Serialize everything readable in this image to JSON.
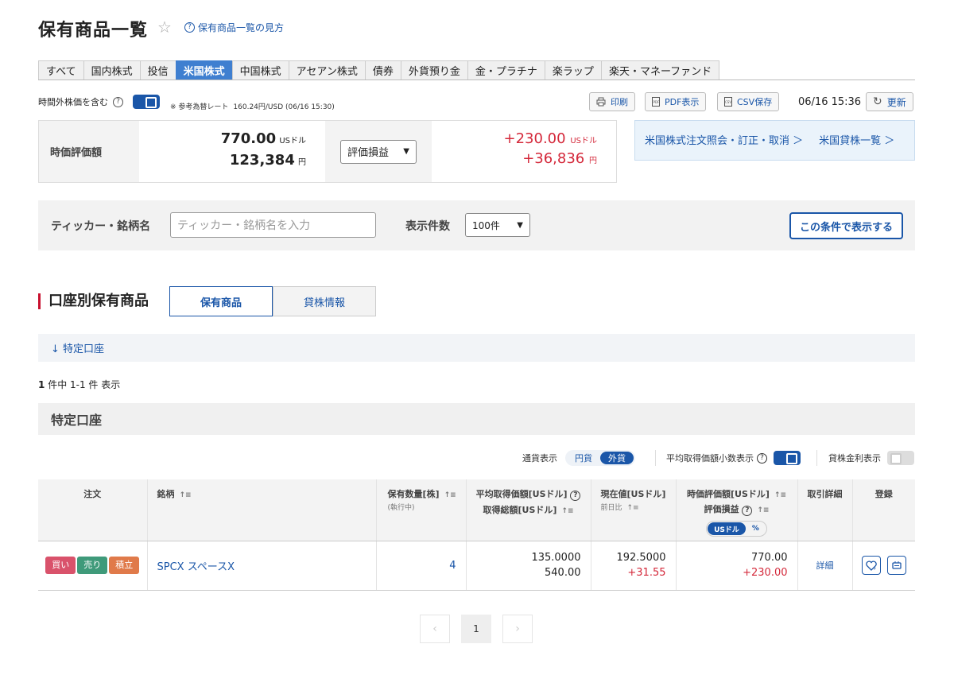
{
  "header": {
    "title": "保有商品一覧",
    "help_link": "保有商品一覧の見方"
  },
  "tabs": [
    {
      "label": "すべて"
    },
    {
      "label": "国内株式"
    },
    {
      "label": "投信"
    },
    {
      "label": "米国株式",
      "active": true
    },
    {
      "label": "中国株式"
    },
    {
      "label": "アセアン株式"
    },
    {
      "label": "債券"
    },
    {
      "label": "外貨預り金"
    },
    {
      "label": "金・プラチナ"
    },
    {
      "label": "楽ラップ"
    },
    {
      "label": "楽天・マネーファンド"
    }
  ],
  "toolbar": {
    "after_hours_label": "時間外株価を含む",
    "after_hours_on": true,
    "fx_note": "※ 参考為替レート",
    "fx_rate": "160.24円/USD (06/16 15:30)",
    "print_label": "印刷",
    "pdf_label": "PDF表示",
    "csv_label": "CSV保存",
    "timestamp": "06/16 15:36",
    "refresh_label": "更新"
  },
  "summary": {
    "label": "時価評価額",
    "usd_value": "770.00",
    "usd_unit": "USドル",
    "jpy_value": "123,384",
    "jpy_unit": "円",
    "select_value": "評価損益",
    "pl_usd": "+230.00",
    "pl_usd_unit": "USドル",
    "pl_jpy": "+36,836",
    "pl_jpy_unit": "円"
  },
  "links": {
    "orders": "米国株式注文照会・訂正・取消",
    "lending": "米国貸株一覧"
  },
  "filter": {
    "label": "ティッカー・銘柄名",
    "placeholder": "ティッカー・銘柄名を入力",
    "count_label": "表示件数",
    "count_value": "100件",
    "submit": "この条件で表示する"
  },
  "section": {
    "title": "口座別保有商品",
    "seg_holdings": "保有商品",
    "seg_lending": "貸株情報",
    "anchor": "特定口座",
    "result_count": "1",
    "result_text": "件中 1-1 件 表示",
    "account_title": "特定口座"
  },
  "display_options": {
    "currency_label": "通貨表示",
    "currency_jpy": "円貨",
    "currency_fx": "外貨",
    "decimal_label": "平均取得価額小数表示",
    "decimal_on": true,
    "lending_rate_label": "貸株金利表示",
    "lending_rate_on": false
  },
  "table": {
    "headers": {
      "order": "注文",
      "name": "銘柄",
      "qty": "保有数量[株]",
      "qty_sub": "(執行中)",
      "avg": "平均取得価額[USドル]",
      "avg2": "取得総額[USドル]",
      "cur": "現在値[USドル]",
      "cur_sub": "前日比",
      "mkt": "時価評価額[USドル]",
      "mkt2": "評価損益",
      "mkt_pill_usd": "USドル",
      "mkt_pill_pct": "%",
      "detail": "取引詳細",
      "reg": "登録"
    },
    "rows": [
      {
        "buy": "買い",
        "sell": "売り",
        "accum": "積立",
        "name": "SPCX スペースX",
        "qty": "4",
        "avg_price": "135.0000",
        "total_cost": "540.00",
        "price": "192.5000",
        "change": "+31.55",
        "market_value": "770.00",
        "pl": "+230.00",
        "detail": "詳細"
      }
    ]
  },
  "pager": {
    "prev": "‹",
    "current": "1",
    "next": "›"
  },
  "colors": {
    "accent": "#1a56a8",
    "tab_active": "#3f7fd0",
    "profit": "#d4283a",
    "buy": "#d9526b",
    "sell": "#3f9a7a",
    "accum": "#e07a4a",
    "title_bar": "#c8102e"
  }
}
